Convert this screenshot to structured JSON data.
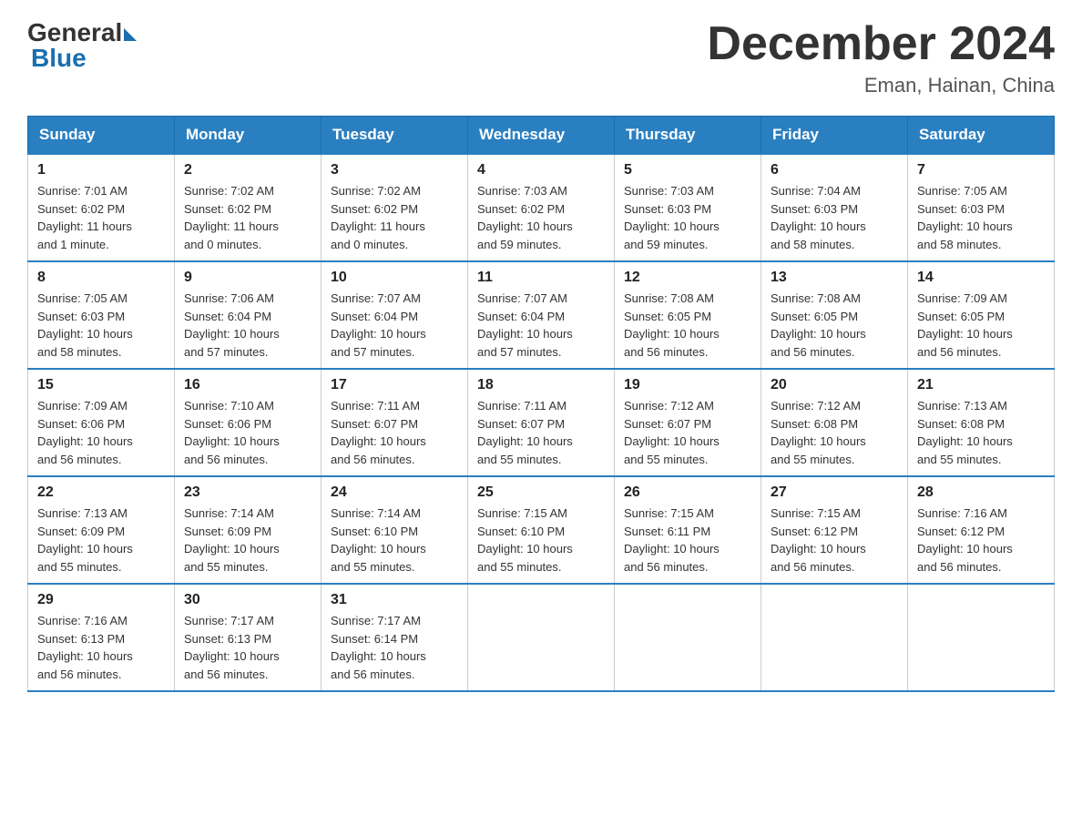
{
  "header": {
    "logo_general": "General",
    "logo_blue": "Blue",
    "month_title": "December 2024",
    "subtitle": "Eman, Hainan, China"
  },
  "days_of_week": [
    "Sunday",
    "Monday",
    "Tuesday",
    "Wednesday",
    "Thursday",
    "Friday",
    "Saturday"
  ],
  "weeks": [
    [
      {
        "day": "1",
        "info": "Sunrise: 7:01 AM\nSunset: 6:02 PM\nDaylight: 11 hours\nand 1 minute."
      },
      {
        "day": "2",
        "info": "Sunrise: 7:02 AM\nSunset: 6:02 PM\nDaylight: 11 hours\nand 0 minutes."
      },
      {
        "day": "3",
        "info": "Sunrise: 7:02 AM\nSunset: 6:02 PM\nDaylight: 11 hours\nand 0 minutes."
      },
      {
        "day": "4",
        "info": "Sunrise: 7:03 AM\nSunset: 6:02 PM\nDaylight: 10 hours\nand 59 minutes."
      },
      {
        "day": "5",
        "info": "Sunrise: 7:03 AM\nSunset: 6:03 PM\nDaylight: 10 hours\nand 59 minutes."
      },
      {
        "day": "6",
        "info": "Sunrise: 7:04 AM\nSunset: 6:03 PM\nDaylight: 10 hours\nand 58 minutes."
      },
      {
        "day": "7",
        "info": "Sunrise: 7:05 AM\nSunset: 6:03 PM\nDaylight: 10 hours\nand 58 minutes."
      }
    ],
    [
      {
        "day": "8",
        "info": "Sunrise: 7:05 AM\nSunset: 6:03 PM\nDaylight: 10 hours\nand 58 minutes."
      },
      {
        "day": "9",
        "info": "Sunrise: 7:06 AM\nSunset: 6:04 PM\nDaylight: 10 hours\nand 57 minutes."
      },
      {
        "day": "10",
        "info": "Sunrise: 7:07 AM\nSunset: 6:04 PM\nDaylight: 10 hours\nand 57 minutes."
      },
      {
        "day": "11",
        "info": "Sunrise: 7:07 AM\nSunset: 6:04 PM\nDaylight: 10 hours\nand 57 minutes."
      },
      {
        "day": "12",
        "info": "Sunrise: 7:08 AM\nSunset: 6:05 PM\nDaylight: 10 hours\nand 56 minutes."
      },
      {
        "day": "13",
        "info": "Sunrise: 7:08 AM\nSunset: 6:05 PM\nDaylight: 10 hours\nand 56 minutes."
      },
      {
        "day": "14",
        "info": "Sunrise: 7:09 AM\nSunset: 6:05 PM\nDaylight: 10 hours\nand 56 minutes."
      }
    ],
    [
      {
        "day": "15",
        "info": "Sunrise: 7:09 AM\nSunset: 6:06 PM\nDaylight: 10 hours\nand 56 minutes."
      },
      {
        "day": "16",
        "info": "Sunrise: 7:10 AM\nSunset: 6:06 PM\nDaylight: 10 hours\nand 56 minutes."
      },
      {
        "day": "17",
        "info": "Sunrise: 7:11 AM\nSunset: 6:07 PM\nDaylight: 10 hours\nand 56 minutes."
      },
      {
        "day": "18",
        "info": "Sunrise: 7:11 AM\nSunset: 6:07 PM\nDaylight: 10 hours\nand 55 minutes."
      },
      {
        "day": "19",
        "info": "Sunrise: 7:12 AM\nSunset: 6:07 PM\nDaylight: 10 hours\nand 55 minutes."
      },
      {
        "day": "20",
        "info": "Sunrise: 7:12 AM\nSunset: 6:08 PM\nDaylight: 10 hours\nand 55 minutes."
      },
      {
        "day": "21",
        "info": "Sunrise: 7:13 AM\nSunset: 6:08 PM\nDaylight: 10 hours\nand 55 minutes."
      }
    ],
    [
      {
        "day": "22",
        "info": "Sunrise: 7:13 AM\nSunset: 6:09 PM\nDaylight: 10 hours\nand 55 minutes."
      },
      {
        "day": "23",
        "info": "Sunrise: 7:14 AM\nSunset: 6:09 PM\nDaylight: 10 hours\nand 55 minutes."
      },
      {
        "day": "24",
        "info": "Sunrise: 7:14 AM\nSunset: 6:10 PM\nDaylight: 10 hours\nand 55 minutes."
      },
      {
        "day": "25",
        "info": "Sunrise: 7:15 AM\nSunset: 6:10 PM\nDaylight: 10 hours\nand 55 minutes."
      },
      {
        "day": "26",
        "info": "Sunrise: 7:15 AM\nSunset: 6:11 PM\nDaylight: 10 hours\nand 56 minutes."
      },
      {
        "day": "27",
        "info": "Sunrise: 7:15 AM\nSunset: 6:12 PM\nDaylight: 10 hours\nand 56 minutes."
      },
      {
        "day": "28",
        "info": "Sunrise: 7:16 AM\nSunset: 6:12 PM\nDaylight: 10 hours\nand 56 minutes."
      }
    ],
    [
      {
        "day": "29",
        "info": "Sunrise: 7:16 AM\nSunset: 6:13 PM\nDaylight: 10 hours\nand 56 minutes."
      },
      {
        "day": "30",
        "info": "Sunrise: 7:17 AM\nSunset: 6:13 PM\nDaylight: 10 hours\nand 56 minutes."
      },
      {
        "day": "31",
        "info": "Sunrise: 7:17 AM\nSunset: 6:14 PM\nDaylight: 10 hours\nand 56 minutes."
      },
      null,
      null,
      null,
      null
    ]
  ]
}
